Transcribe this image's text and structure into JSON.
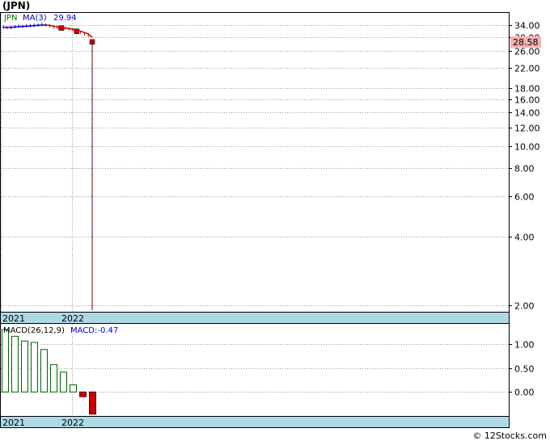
{
  "header": {
    "title": "(JPN)"
  },
  "footer": {
    "credit": "© 12Stocks.com"
  },
  "chart_data": [
    {
      "type": "line",
      "panel": "price",
      "scale": "log",
      "ylim": [
        1.9,
        38
      ],
      "ticks": [
        "34.00",
        "30.00",
        "26.00",
        "22.00",
        "18.00",
        "16.00",
        "14.00",
        "12.00",
        "10.00",
        "8.00",
        "6.00",
        "4.00",
        "2.00"
      ],
      "tick_values": [
        34,
        30,
        26,
        22,
        18,
        16,
        14,
        12,
        10,
        8,
        6,
        4,
        2
      ],
      "x_labels": [
        "2021",
        "2022"
      ],
      "legend": {
        "symbol": "JPN",
        "ma": "MA(3)",
        "ma_value": "29.94"
      },
      "last_price_label": "28.58",
      "colors": {
        "up": "#0000cc",
        "down": "#cc0000",
        "ma": "#0000cc",
        "ma_down": "#cc0000",
        "last_bg": "#f4b0b0",
        "axis_band": "#add8e6"
      },
      "series": [
        {
          "name": "JPN",
          "kind": "price",
          "values": [
            33.2,
            33.0,
            33.1,
            33.3,
            33.5,
            33.4,
            33.6,
            33.7,
            33.8,
            33.9,
            34.1,
            33.9,
            33.6,
            33.2,
            33.0,
            32.9,
            32.8,
            32.5,
            32.3,
            31.8,
            31.5,
            31.0,
            30.5,
            28.58
          ],
          "min_low": 1.9
        },
        {
          "name": "MA(3)",
          "kind": "ma",
          "values": [
            33.1,
            33.1,
            33.1,
            33.2,
            33.3,
            33.4,
            33.5,
            33.6,
            33.7,
            33.8,
            33.9,
            33.9,
            33.8,
            33.5,
            33.3,
            33.0,
            32.9,
            32.7,
            32.5,
            32.2,
            31.9,
            31.4,
            31.0,
            29.94
          ]
        }
      ]
    },
    {
      "type": "bar",
      "panel": "macd",
      "ylim": [
        -0.5,
        1.4
      ],
      "ticks": [
        "1.00",
        "0.50",
        "0.00"
      ],
      "tick_values": [
        1.0,
        0.5,
        0.0
      ],
      "x_labels": [
        "2021",
        "2022"
      ],
      "legend": {
        "label": "MACD(26,12,9)",
        "value_label": "MACD:-0.47"
      },
      "values": [
        1.32,
        1.18,
        1.08,
        1.05,
        0.9,
        0.58,
        0.42,
        0.15,
        -0.1,
        -0.47
      ],
      "colors": {
        "positive": "#006400",
        "negative": "#cc0000"
      }
    }
  ]
}
